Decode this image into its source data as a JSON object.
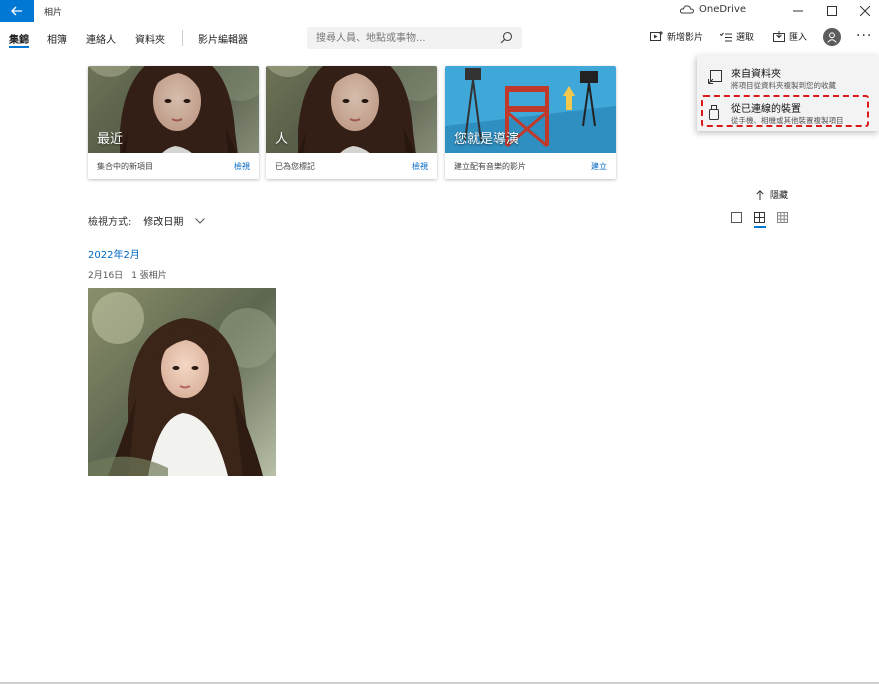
{
  "window": {
    "title": "相片",
    "onedrive_label": "OneDrive"
  },
  "nav": {
    "tabs": [
      {
        "label": "集錦",
        "active": true
      },
      {
        "label": "相簿"
      },
      {
        "label": "連絡人"
      },
      {
        "label": "資料夾"
      },
      {
        "label": "影片編輯器"
      }
    ],
    "search_placeholder": "搜尋人員、地點或事物..."
  },
  "toolbar": {
    "new_video": "新增影片",
    "select": "選取",
    "import": "匯入"
  },
  "cards": [
    {
      "title": "最近",
      "desc": "集合中的新項目",
      "link": "檢視"
    },
    {
      "title": "人",
      "desc": "已為您標記",
      "link": "檢視"
    },
    {
      "title": "您就是導演",
      "desc": "建立配有音樂的影片",
      "link": "建立"
    }
  ],
  "hide_label": "隱藏",
  "view_by": {
    "label": "檢視方式:",
    "value": "修改日期"
  },
  "group": {
    "month": "2022年2月",
    "day": "2月16日",
    "count": "1 張相片"
  },
  "import_menu": {
    "items": [
      {
        "title": "來自資料夾",
        "subtitle": "將項目從資料夾複製到您的收藏"
      },
      {
        "title": "從已連線的裝置",
        "subtitle": "從手機、相機或其他裝置複製項目"
      }
    ]
  },
  "colors": {
    "accent": "#0078d4",
    "link": "#0067c0",
    "highlight": "#d91a1a"
  }
}
